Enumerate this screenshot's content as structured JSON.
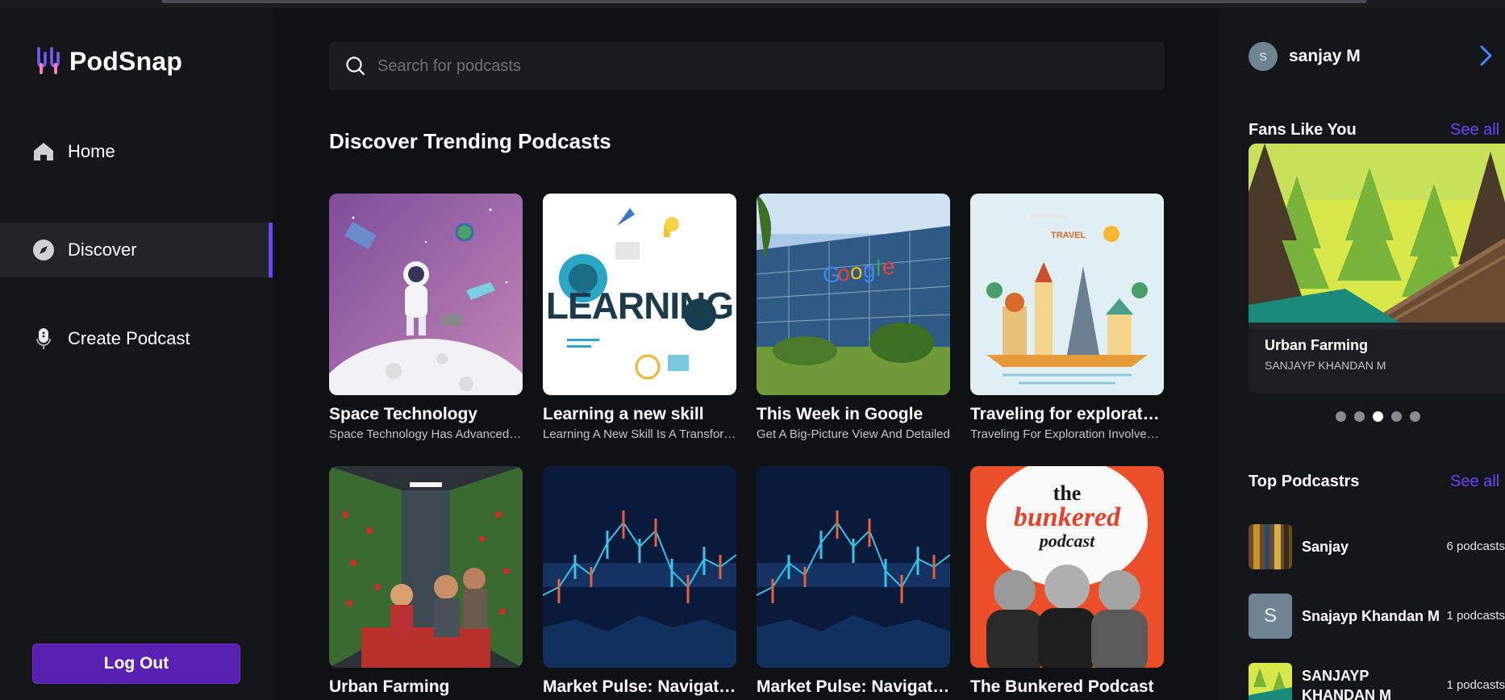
{
  "app": {
    "name": "PodSnap"
  },
  "nav": [
    {
      "label": "Home",
      "icon": "home-icon",
      "active": false
    },
    {
      "label": "Discover",
      "icon": "compass-icon",
      "active": true
    },
    {
      "label": "Create Podcast",
      "icon": "microphone-icon",
      "active": false
    }
  ],
  "logout_label": "Log Out",
  "search": {
    "placeholder": "Search for podcasts"
  },
  "section_title": "Discover Trending Podcasts",
  "podcasts": [
    {
      "title": "Space Technology",
      "description": "Space Technology Has Advanced Rapidly",
      "art": "space"
    },
    {
      "title": "Learning a new skill",
      "description": "Learning A New Skill Is A Transformative",
      "art": "learning"
    },
    {
      "title": "This Week in Google",
      "description": "Get A Big-Picture View And Detailed",
      "art": "google"
    },
    {
      "title": "Traveling for exploration",
      "description": "Traveling For Exploration Involves Visiting",
      "art": "travel"
    },
    {
      "title": "Urban Farming",
      "description": "",
      "art": "farming"
    },
    {
      "title": "Market Pulse: Navigating the Markets",
      "description": "",
      "art": "market"
    },
    {
      "title": "Market Pulse: Navigating the Markets",
      "description": "",
      "art": "market"
    },
    {
      "title": "The Bunkered Podcast",
      "description": "",
      "art": "bunkered"
    }
  ],
  "user": {
    "name": "sanjay M",
    "initial": "S"
  },
  "fans": {
    "heading": "Fans Like You",
    "see_all": "See all",
    "featured": {
      "title": "Urban Farming",
      "author": "SANJAYP KHANDAN M"
    },
    "dots": 5,
    "active_dot": 2
  },
  "top": {
    "heading": "Top Podcastrs",
    "see_all": "See all",
    "items": [
      {
        "name": "Sanjay",
        "count": "6 podcasts",
        "thumb": "abstract"
      },
      {
        "name": "Snajayp Khandan M",
        "count": "1 podcasts",
        "thumb": "initial",
        "initial": "S"
      },
      {
        "name": "SANJAYP KHANDAN M",
        "count": "1 podcasts",
        "thumb": "forest"
      }
    ]
  },
  "colors": {
    "accent": "#6b46ff",
    "logout": "#5a1fb3",
    "background": "#101114",
    "panel": "#15161a"
  }
}
